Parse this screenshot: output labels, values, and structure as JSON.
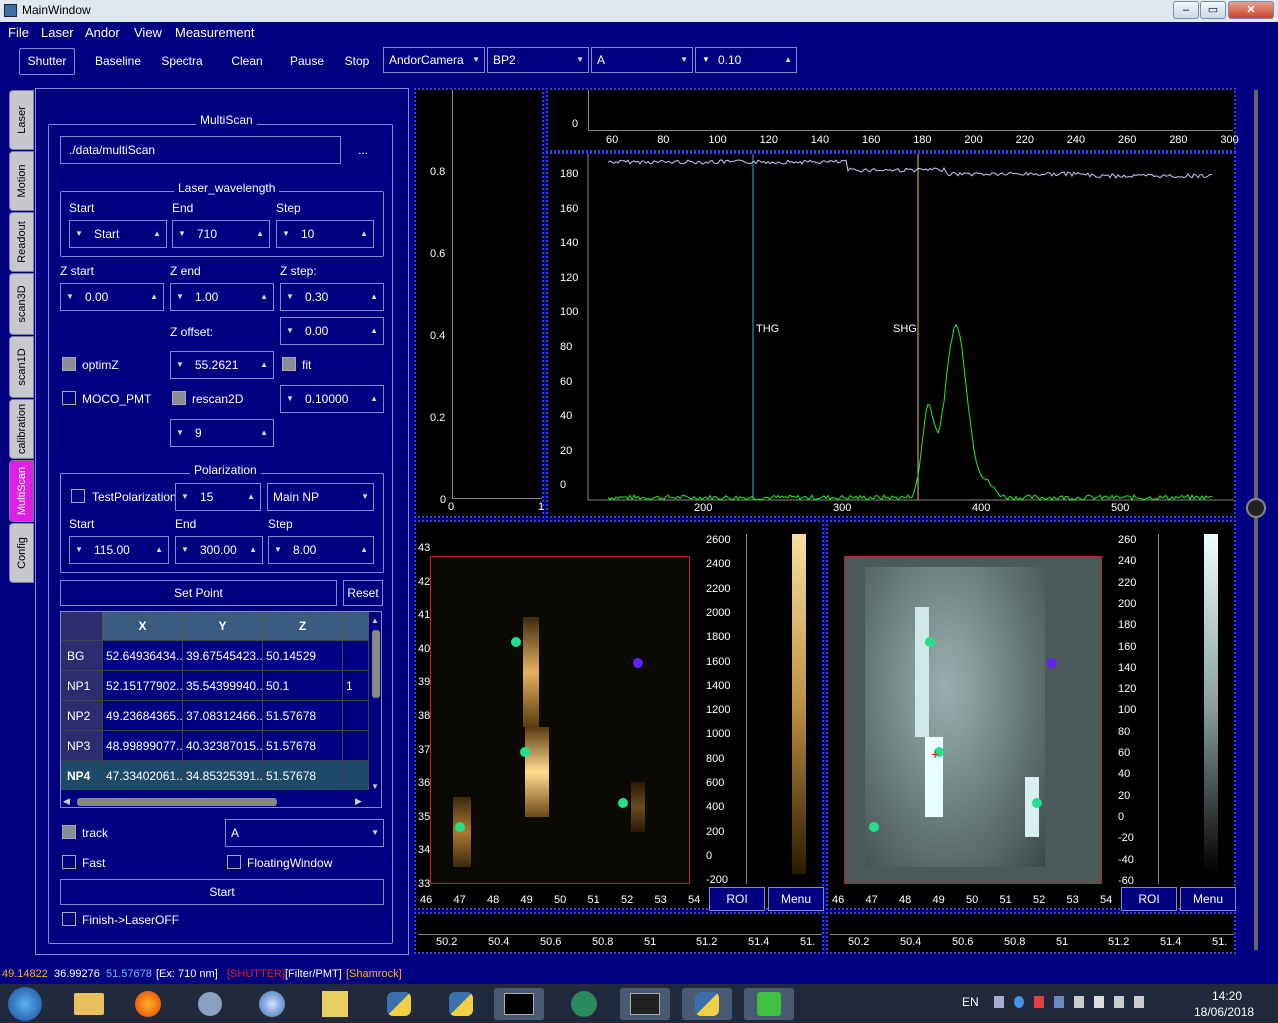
{
  "window": {
    "title": "MainWindow",
    "min": "–",
    "max": "▭",
    "close": "✕"
  },
  "menu": {
    "file": "File",
    "laser": "Laser",
    "andor": "Andor",
    "view": "View",
    "measurement": "Measurement"
  },
  "toolbar": {
    "shutter": "Shutter",
    "baseline": "Baseline",
    "spectra": "Spectra",
    "clean": "Clean",
    "pause": "Pause",
    "stop": "Stop",
    "camera": "AndorCamera",
    "filter": "BP2",
    "mode": "A",
    "exposure": "0.10"
  },
  "tabs": [
    "Laser",
    "Motion",
    "Readout",
    "scan3D",
    "scan1D",
    "calibration",
    "MultiScan",
    "Config"
  ],
  "multiscan": {
    "title": "MultiScan",
    "path": "./data/multiScan",
    "browse": "...",
    "laser_group": "Laser_wavelength",
    "start_label": "Start",
    "end_label": "End",
    "step_label": "Step",
    "start": "Start",
    "end": "710",
    "step": "10",
    "zstart_label": "Z start",
    "zend_label": "Z end",
    "zstep_label": "Z step:",
    "zstart": "0.00",
    "zend": "1.00",
    "zstep": "0.30",
    "zoffset_label": "Z offset:",
    "zoffset": "0.00",
    "optimz": "optimZ",
    "optimz_val": "55.2621",
    "fit": "fit",
    "moco": "MOCO_PMT",
    "rescan": "rescan2D",
    "rescan_val": "0.10000",
    "nine": "9",
    "pol_group": "Polarization",
    "testpol": "TestPolarization",
    "pol_n": "15",
    "pol_target": "Main NP",
    "pol_start_label": "Start",
    "pol_end_label": "End",
    "pol_step_label": "Step",
    "pol_start": "115.00",
    "pol_end": "300.00",
    "pol_step": "8.00",
    "setpoint": "Set Point",
    "reset": "Reset",
    "table": {
      "headers": [
        "X",
        "Y",
        "Z"
      ],
      "rows": [
        {
          "name": "BG",
          "x": "52.64936434...",
          "y": "39.67545423...",
          "z": "50.14529",
          "e": ""
        },
        {
          "name": "NP1",
          "x": "52.15177902...",
          "y": "35.54399940...",
          "z": "50.1",
          "e": "1"
        },
        {
          "name": "NP2",
          "x": "49.23684365...",
          "y": "37.08312466...",
          "z": "51.57678",
          "e": ""
        },
        {
          "name": "NP3",
          "x": "48.99899077...",
          "y": "40.32387015...",
          "z": "51.57678",
          "e": ""
        },
        {
          "name": "NP4",
          "x": "47.33402061...",
          "y": "34.85325391...",
          "z": "51.57678",
          "e": ""
        }
      ]
    },
    "track": "track",
    "track_sel": "A",
    "fast": "Fast",
    "floating": "FloatingWindow",
    "finish": "Finish->LaserOFF"
  },
  "plots": {
    "topleft_y": [
      "0.8",
      "0.6",
      "0.4",
      "0.2",
      "0"
    ],
    "topleft_x": [
      "0",
      "1"
    ],
    "top_x": [
      "60",
      "80",
      "100",
      "120",
      "140",
      "160",
      "180",
      "200",
      "220",
      "240",
      "260",
      "280",
      "300"
    ],
    "top_y": "0",
    "spec_y": [
      "180",
      "160",
      "140",
      "120",
      "100",
      "80",
      "60",
      "40",
      "20",
      "0"
    ],
    "spec_x": [
      "200",
      "300",
      "400",
      "500"
    ],
    "thg": "THG",
    "shg": "SHG",
    "img1_y": [
      "43",
      "42",
      "41",
      "40",
      "39",
      "38",
      "37",
      "36",
      "35",
      "34",
      "33"
    ],
    "img1_x": [
      "46",
      "47",
      "48",
      "49",
      "50",
      "51",
      "52",
      "53",
      "54"
    ],
    "cb1": [
      "2600",
      "2400",
      "2200",
      "2000",
      "1800",
      "1600",
      "1400",
      "1200",
      "1000",
      "800",
      "600",
      "400",
      "200",
      "0",
      "-200"
    ],
    "img2_x": [
      "46",
      "47",
      "48",
      "49",
      "50",
      "51",
      "52",
      "53",
      "54"
    ],
    "cb2": [
      "260",
      "240",
      "220",
      "200",
      "180",
      "160",
      "140",
      "120",
      "100",
      "80",
      "60",
      "40",
      "20",
      "0",
      "-20",
      "-40",
      "-60"
    ],
    "roi": "ROI",
    "menu": "Menu",
    "bottom_x": [
      "50.2",
      "50.4",
      "50.6",
      "50.8",
      "51",
      "51.2",
      "51.4",
      "51."
    ]
  },
  "status": {
    "x": "49.14822",
    "y": "36.99276",
    "z": "51.57678",
    "ex": "[Ex: 710 nm]",
    "shutter": "[SHUTTER]",
    "filter": "[Filter/PMT]",
    "shamrock": "[Shamrock]"
  },
  "taskbar": {
    "lang": "EN",
    "time": "14:20",
    "date": "18/06/2018"
  },
  "colors": {
    "bg": "#000080",
    "spectrum": "#22ee22",
    "ref": "#c8c8ff",
    "thg_line": "#3ab0c8",
    "shg_line": "#e8c060",
    "dot": "#22e08a",
    "dot2": "#6020ff"
  }
}
